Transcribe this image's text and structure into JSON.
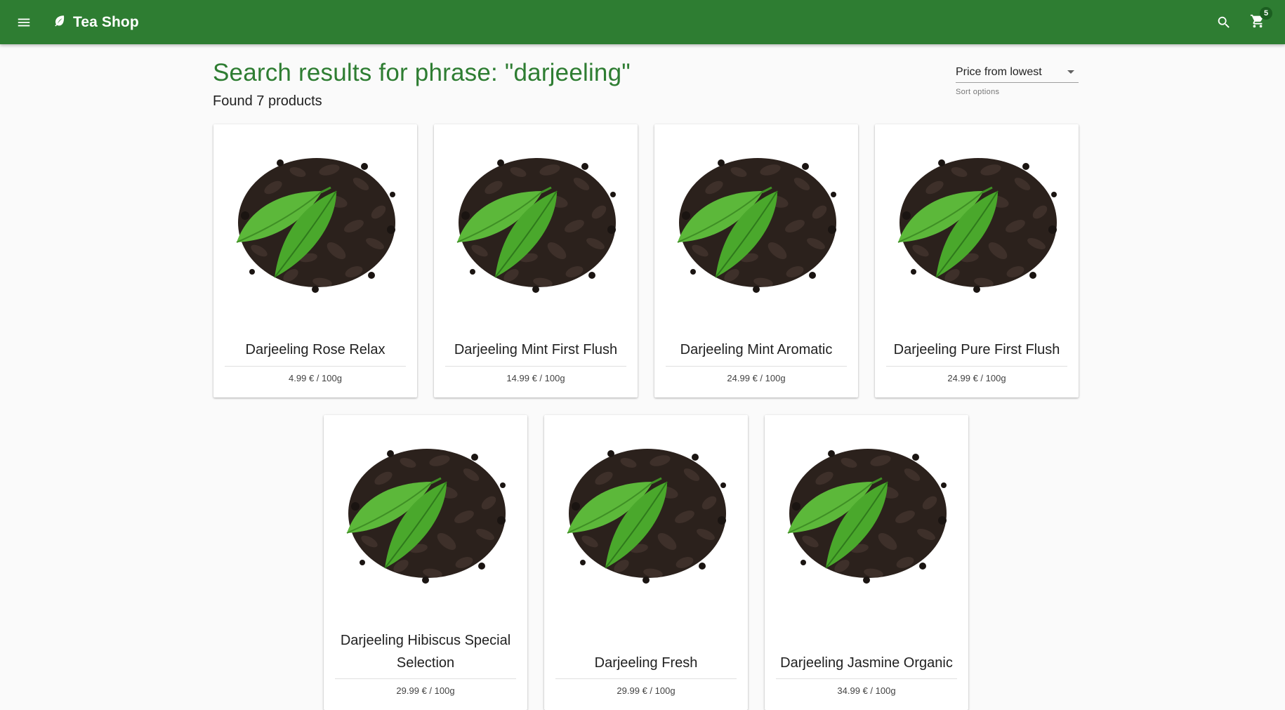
{
  "header": {
    "title": "Tea Shop",
    "menu_icon": "menu-icon",
    "brand_icon": "leaf-icon",
    "search_icon": "search-icon",
    "cart_icon": "cart-icon",
    "cart_count": "5",
    "bar_color": "#2e7d32"
  },
  "results": {
    "heading": "Search results for phrase: \"darjeeling\"",
    "count_text": "Found 7 products"
  },
  "sort": {
    "selected": "Price from lowest",
    "hint": "Sort options"
  },
  "products": [
    {
      "name": "Darjeeling Rose Relax",
      "price": "4.99 € / 100g"
    },
    {
      "name": "Darjeeling Mint First Flush",
      "price": "14.99 € / 100g"
    },
    {
      "name": "Darjeeling Mint Aromatic",
      "price": "24.99 € / 100g"
    },
    {
      "name": "Darjeeling Pure First Flush",
      "price": "24.99 € / 100g"
    },
    {
      "name": "Darjeeling Hibiscus Special Selection",
      "price": "29.99 € / 100g"
    },
    {
      "name": "Darjeeling Fresh",
      "price": "29.99 € / 100g"
    },
    {
      "name": "Darjeeling Jasmine Organic",
      "price": "34.99 € / 100g"
    }
  ]
}
